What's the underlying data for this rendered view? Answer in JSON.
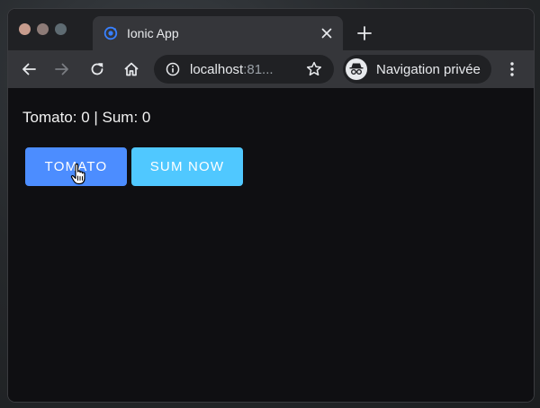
{
  "browser": {
    "tab": {
      "title": "Ionic App"
    },
    "address_bar": {
      "host": "localhost",
      "port_truncated": ":81..."
    },
    "profile": {
      "label": "Navigation privée"
    }
  },
  "page": {
    "status": {
      "text": "Tomato: 0 | Sum: 0"
    },
    "buttons": {
      "tomato": "TOMATO",
      "sum_now": "SUM NOW"
    }
  },
  "colors": {
    "primary": "#4c8dff",
    "secondary": "#50c8ff",
    "page_background": "#0f0f12",
    "chrome_toolbar": "#35363a",
    "chrome_titlebar": "#202124"
  },
  "icons": [
    "ionic-logo-icon",
    "close-icon",
    "plus-icon",
    "back-arrow-icon",
    "forward-arrow-icon",
    "reload-icon",
    "home-icon",
    "info-icon",
    "star-icon",
    "incognito-icon",
    "kebab-menu-icon",
    "hand-pointer-cursor-icon"
  ]
}
